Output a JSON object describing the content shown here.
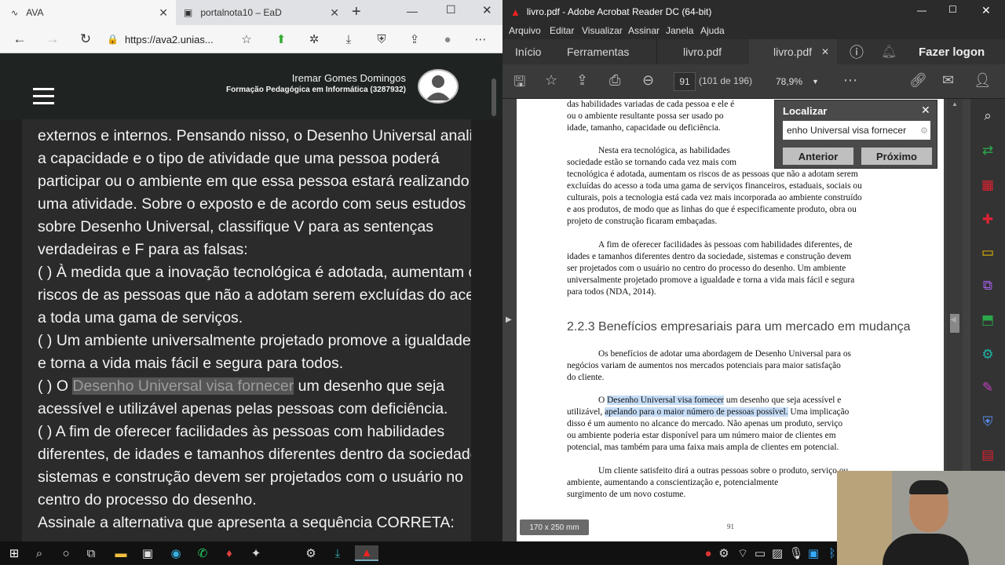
{
  "browser": {
    "tabs": [
      {
        "label": "AVA"
      },
      {
        "label": "portalnota10 – EaD"
      }
    ],
    "url": "https://ava2.unias..."
  },
  "ava": {
    "user_name": "Iremar Gomes Domingos",
    "user_course": "Formação Pedagógica em Informática (3287932)",
    "question_lines": [
      "externos e internos. Pensando nisso, o Desenho Universal analisa",
      "a capacidade e o tipo de atividade que uma pessoa poderá",
      "participar ou o ambiente em que essa pessoa estará realizando",
      "uma atividade. Sobre o exposto e de acordo com seus estudos",
      "sobre Desenho Universal, classifique V para as sentenças",
      "verdadeiras e F para as falsas:",
      "(    ) À medida que a inovação tecnológica é adotada, aumentam os",
      "riscos de as pessoas que não a adotam serem excluídas do acesso",
      "a toda uma gama de serviços.",
      "(    ) Um ambiente universalmente projetado promove a igualdade",
      "e torna a vida mais fácil e segura para todos."
    ],
    "line12_prefix": "(    ) O ",
    "line12_highlight": "Desenho Universal visa fornecer",
    "line12_suffix": " um desenho que seja",
    "question_lines_b": [
      "acessível e utilizável apenas pelas pessoas com deficiência.",
      "(    ) A fim de oferecer facilidades às pessoas com habilidades",
      "diferentes, de idades e tamanhos diferentes dentro da sociedade,",
      "sistemas e construção devem ser projetados com o usuário no",
      "centro do processo do desenho.",
      "Assinale a alternativa que apresenta a sequência CORRETA:"
    ]
  },
  "acrobat": {
    "title": "livro.pdf - Adobe Acrobat Reader DC (64-bit)",
    "menu": [
      "Arquivo",
      "Editar",
      "Visualizar",
      "Assinar",
      "Janela",
      "Ajuda"
    ],
    "tabs": {
      "home": "Início",
      "tools": "Ferramentas",
      "doc1": "livro.pdf",
      "doc2": "livro.pdf",
      "login": "Fazer logon"
    },
    "page_current": "91",
    "page_count": "(101 de 196)",
    "zoom": "78,9%",
    "find": {
      "title": "Localizar",
      "query": "enho Universal visa fornecer",
      "prev": "Anterior",
      "next": "Próximo"
    },
    "page_dims": "170 x 250 mm",
    "page_footer": "91",
    "pdf": {
      "p1": [
        "das habilidades variadas de cada pessoa e ele é",
        "ou o ambiente resultante possa ser usado po",
        "idade, tamanho, capacidade ou deficiência."
      ],
      "p2": [
        "Nesta era tecnológica, as habilidades",
        "sociedade estão se tornando cada vez mais com",
        "tecnológica é adotada, aumentam os riscos de as pessoas que não a adotam serem",
        "excluídas do acesso a toda uma gama de serviços financeiros, estaduais, sociais ou",
        "culturais, pois a tecnologia está cada vez mais incorporada ao ambiente construído",
        "e aos produtos, de modo que as linhas do que é especificamente produto, obra ou",
        "projeto de construção ficaram embaçadas."
      ],
      "p3": [
        "A fim de oferecer facilidades às pessoas com habilidades diferentes, de",
        "idades e tamanhos diferentes dentro da sociedade, sistemas e construção devem",
        "ser projetados com o usuário no centro do processo do desenho. Um ambiente",
        "universalmente projetado promove a igualdade e torna a vida mais fácil e segura",
        "para todos (NDA, 2014)."
      ],
      "heading": "2.2.3 Benefícios empresariais para um mercado em mudança",
      "p4": [
        "Os benefícios de adotar uma abordagem de Desenho Universal para os",
        "negócios variam de aumentos nos mercados potenciais para maior satisfação",
        "do cliente."
      ],
      "p5_l1_pre": "O ",
      "p5_l1_sel": "Desenho Universal visa fornecer",
      "p5_l1_post": " um desenho que seja acessível e",
      "p5_l2_pre": "utilizável, ",
      "p5_l2_sel": "apelando para o maior número de pessoas possível.",
      "p5_l2_post": " Uma implicação",
      "p5_rest": [
        "disso é um aumento no alcance do mercado. Não apenas um produto, serviço",
        "ou ambiente poderia estar disponível para um número maior de clientes em",
        "potencial, mas também para uma faixa mais ampla de clientes em potencial."
      ],
      "p6": [
        "Um cliente satisfeito dirá a outras pessoas sobre o produto, serviço ou",
        "ambiente, aumentando a conscientização e, potencialmente",
        "surgimento de um novo costume."
      ]
    }
  }
}
